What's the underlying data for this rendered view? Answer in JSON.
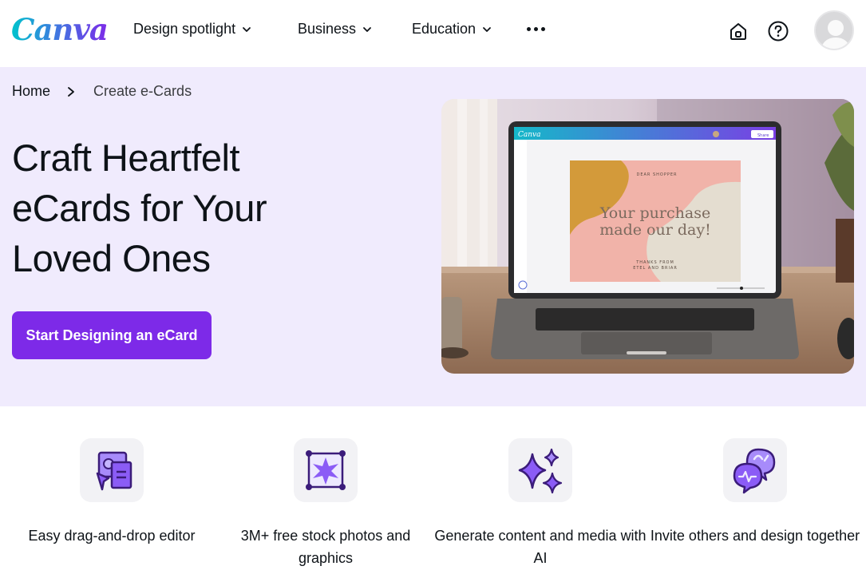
{
  "header": {
    "logo_text": "Canva",
    "nav": [
      {
        "label": "Design spotlight"
      },
      {
        "label": "Business"
      },
      {
        "label": "Education"
      }
    ],
    "icons": [
      "home-icon",
      "help-icon",
      "avatar"
    ]
  },
  "breadcrumb": {
    "home": "Home",
    "current": "Create e-Cards"
  },
  "hero": {
    "title": "Craft Heartfelt eCards for Your Loved Ones",
    "cta_label": "Start Designing an eCard",
    "image": {
      "editor_logo": "Canva",
      "share_label": "Share",
      "card_greeting": "DEAR SHOPPER",
      "card_headline_1": "Your purchase",
      "card_headline_2": "made our day!",
      "card_signoff_1": "THANKS FROM",
      "card_signoff_2": "ETEL AND BRIAR"
    }
  },
  "features": [
    {
      "icon": "drag-drop-icon",
      "label": "Easy drag-and-drop editor"
    },
    {
      "icon": "stock-photos-icon",
      "label": "3M+ free stock photos and graphics"
    },
    {
      "icon": "ai-sparkle-icon",
      "label": "Generate content and media with AI"
    },
    {
      "icon": "collaborate-chat-icon",
      "label": "Invite others and design together"
    }
  ],
  "colors": {
    "brand_purple": "#7d2ae8",
    "hero_bg": "#f0ebfd",
    "icon_purple": "#8b5cf6"
  }
}
